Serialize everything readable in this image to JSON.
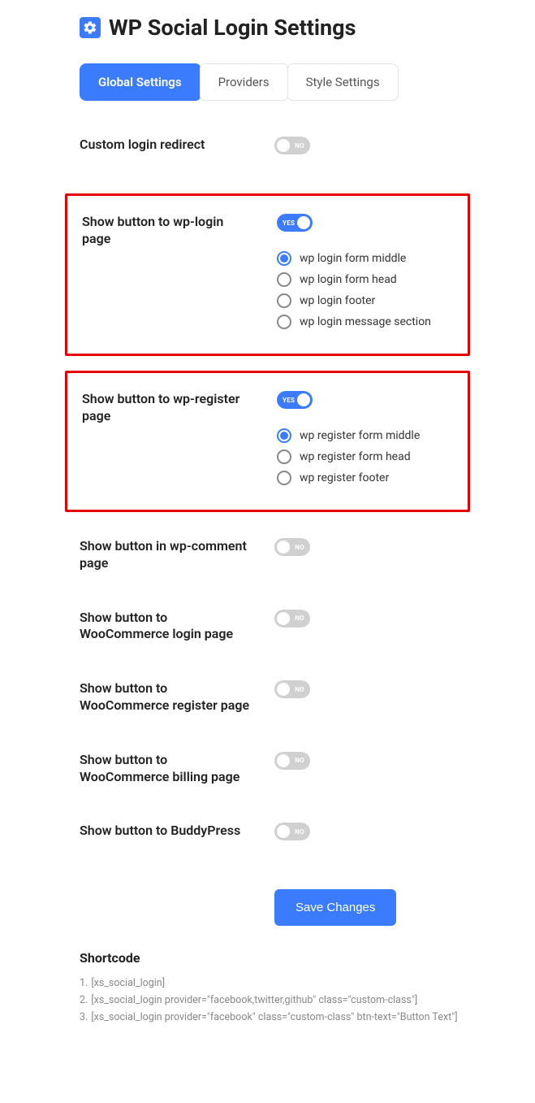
{
  "header": {
    "title": "WP Social Login Settings"
  },
  "tabs": [
    {
      "label": "Global Settings",
      "active": true
    },
    {
      "label": "Providers",
      "active": false
    },
    {
      "label": "Style Settings",
      "active": false
    }
  ],
  "toggle_text": {
    "on": "YES",
    "off": "NO"
  },
  "settings": {
    "custom_redirect": {
      "label": "Custom login redirect",
      "value": false
    },
    "wp_login": {
      "label": "Show button to wp-login page",
      "value": true,
      "options": [
        {
          "label": "wp login form middle",
          "checked": true
        },
        {
          "label": "wp login form head",
          "checked": false
        },
        {
          "label": "wp login footer",
          "checked": false
        },
        {
          "label": "wp login message section",
          "checked": false
        }
      ]
    },
    "wp_register": {
      "label": "Show button to wp-register page",
      "value": true,
      "options": [
        {
          "label": "wp register form middle",
          "checked": true
        },
        {
          "label": "wp register form head",
          "checked": false
        },
        {
          "label": "wp register footer",
          "checked": false
        }
      ]
    },
    "wp_comment": {
      "label": "Show button in wp-comment page",
      "value": false
    },
    "wc_login": {
      "label": "Show button to WooCommerce login page",
      "value": false
    },
    "wc_register": {
      "label": "Show button to WooCommerce register page",
      "value": false
    },
    "wc_billing": {
      "label": "Show button to WooCommerce billing page",
      "value": false
    },
    "buddypress": {
      "label": "Show button to BuddyPress",
      "value": false
    }
  },
  "save_button": "Save Changes",
  "shortcode": {
    "heading": "Shortcode",
    "lines": [
      {
        "num": "1.",
        "text": "[xs_social_login]"
      },
      {
        "num": "2.",
        "text": "[xs_social_login provider=\"facebook,twitter,github\" class=\"custom-class\"]"
      },
      {
        "num": "3.",
        "text": "[xs_social_login provider=\"facebook\" class=\"custom-class\" btn-text=\"Button Text\"]"
      }
    ]
  }
}
